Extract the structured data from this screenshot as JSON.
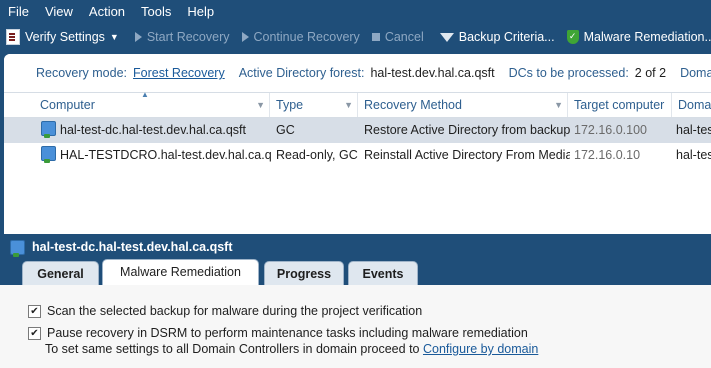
{
  "menu": [
    "File",
    "View",
    "Action",
    "Tools",
    "Help"
  ],
  "toolbar": {
    "verify": "Verify Settings",
    "start": "Start Recovery",
    "continue": "Continue Recovery",
    "cancel": "Cancel",
    "backup_criteria": "Backup Criteria...",
    "malware": "Malware Remediation..."
  },
  "info": {
    "recovery_mode_label": "Recovery mode:",
    "recovery_mode_value": "Forest Recovery",
    "forest_label": "Active Directory forest:",
    "forest_value": "hal-test.dev.hal.ca.qsft",
    "dcs_label": "DCs to be processed:",
    "dcs_value": "2 of 2",
    "domains_label": "Domains to"
  },
  "grid": {
    "columns": [
      "Computer",
      "Type",
      "Recovery Method",
      "Target computer",
      "Domai"
    ],
    "rows": [
      {
        "computer": "hal-test-dc.hal-test.dev.hal.ca.qsft",
        "type": "GC",
        "method": "Restore Active Directory from backup",
        "target": "172.16.0.100",
        "domain": "hal-tes"
      },
      {
        "computer": "HAL-TESTDCRO.hal-test.dev.hal.ca.qsft",
        "type": "Read-only, GC",
        "method": "Reinstall Active Directory From Media",
        "target": "172.16.0.10",
        "domain": "hal-tes"
      }
    ]
  },
  "detail": {
    "title": "hal-test-dc.hal-test.dev.hal.ca.qsft",
    "tabs": [
      "General",
      "Malware Remediation",
      "Progress",
      "Events"
    ],
    "option1": "Scan the selected backup for malware during the project verification",
    "option2": "Pause recovery in DSRM to perform maintenance tasks including malware remediation",
    "note": "To set same settings to all Domain Controllers in domain proceed to",
    "note_link": "Configure by domain"
  }
}
